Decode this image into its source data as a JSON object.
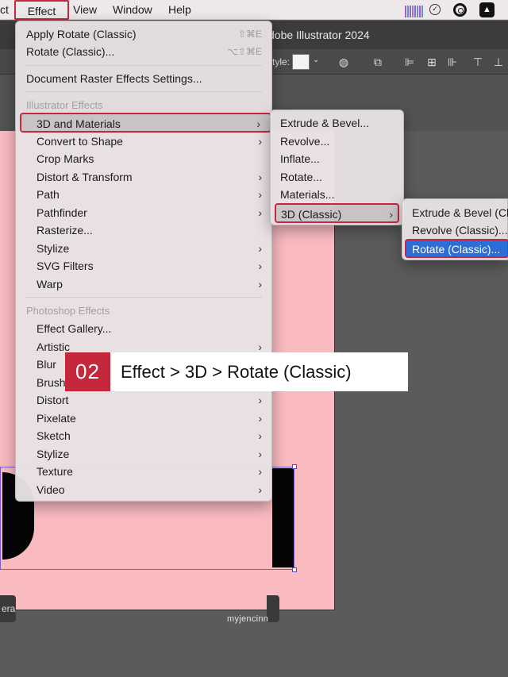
{
  "menubar": {
    "items": [
      "ct",
      "Effect",
      "View",
      "Window",
      "Help"
    ]
  },
  "app": {
    "title": "dobe Illustrator 2024",
    "style_label": "tyle:"
  },
  "effect_menu": {
    "apply_rotate": {
      "label": "Apply Rotate (Classic)",
      "shortcut": "⇧⌘E"
    },
    "rotate": {
      "label": "Rotate (Classic)...",
      "shortcut": "⌥⇧⌘E"
    },
    "doc_raster": "Document Raster Effects Settings...",
    "illustrator_header": "Illustrator Effects",
    "illustrator_items": [
      {
        "label": "3D and Materials",
        "submenu": true
      },
      {
        "label": "Convert to Shape",
        "submenu": true
      },
      {
        "label": "Crop Marks",
        "submenu": false
      },
      {
        "label": "Distort & Transform",
        "submenu": true
      },
      {
        "label": "Path",
        "submenu": true
      },
      {
        "label": "Pathfinder",
        "submenu": true
      },
      {
        "label": "Rasterize...",
        "submenu": false
      },
      {
        "label": "Stylize",
        "submenu": true
      },
      {
        "label": "SVG Filters",
        "submenu": true
      },
      {
        "label": "Warp",
        "submenu": true
      }
    ],
    "photoshop_header": "Photoshop Effects",
    "photoshop_items": [
      {
        "label": "Effect Gallery...",
        "submenu": false
      },
      {
        "label": "Artistic",
        "submenu": true
      },
      {
        "label": "Blur",
        "submenu": true
      },
      {
        "label": "Brush Strokes",
        "submenu": true
      },
      {
        "label": "Distort",
        "submenu": true
      },
      {
        "label": "Pixelate",
        "submenu": true
      },
      {
        "label": "Sketch",
        "submenu": true
      },
      {
        "label": "Stylize",
        "submenu": true
      },
      {
        "label": "Texture",
        "submenu": true
      },
      {
        "label": "Video",
        "submenu": true
      }
    ]
  },
  "materials_menu": {
    "items": [
      "Extrude & Bevel...",
      "Revolve...",
      "Inflate...",
      "Rotate...",
      "Materials...",
      "3D (Classic)"
    ]
  },
  "classic_menu": {
    "items": [
      "Extrude & Bevel (Cla",
      "Revolve (Classic)...",
      "Rotate (Classic)..."
    ]
  },
  "artboard": {
    "left_button_text": "era"
  },
  "callout": {
    "number": "02",
    "text": "Effect > 3D > Rotate (Classic)"
  },
  "watermark": "myjencinn",
  "colors": {
    "accent_red": "#c4283a",
    "highlight_blue": "#2c6ed8",
    "artboard_pink": "#f9bac0"
  }
}
